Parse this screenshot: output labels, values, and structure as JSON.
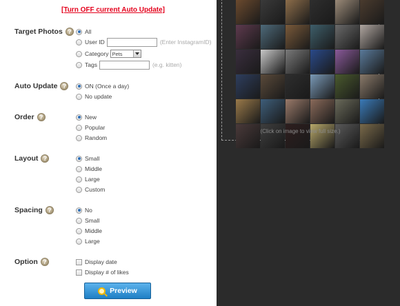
{
  "turn_off_link": "[Turn OFF current Auto Update]",
  "target_photos": {
    "label": "Target Photos",
    "options": [
      {
        "label": "All",
        "selected": true
      },
      {
        "label": "User ID",
        "selected": false,
        "input_value": "",
        "hint": "(Enter InstagramID)"
      },
      {
        "label": "Category",
        "selected": false,
        "select_value": "Pets"
      },
      {
        "label": "Tags",
        "selected": false,
        "input_value": "",
        "hint": "(e.g. kitten)"
      }
    ]
  },
  "auto_update": {
    "label": "Auto Update",
    "options": [
      {
        "label": "ON (Once a day)",
        "selected": true
      },
      {
        "label": "No update",
        "selected": false
      }
    ]
  },
  "order": {
    "label": "Order",
    "options": [
      {
        "label": "New",
        "selected": true
      },
      {
        "label": "Popular",
        "selected": false
      },
      {
        "label": "Random",
        "selected": false
      }
    ]
  },
  "layout": {
    "label": "Layout",
    "options": [
      {
        "label": "Small",
        "selected": true
      },
      {
        "label": "Middle",
        "selected": false
      },
      {
        "label": "Large",
        "selected": false
      },
      {
        "label": "Custom",
        "selected": false
      }
    ]
  },
  "spacing": {
    "label": "Spacing",
    "options": [
      {
        "label": "No",
        "selected": true
      },
      {
        "label": "Small",
        "selected": false
      },
      {
        "label": "Middle",
        "selected": false
      },
      {
        "label": "Large",
        "selected": false
      }
    ]
  },
  "option": {
    "label": "Option",
    "checkboxes": [
      {
        "label": "Display date",
        "checked": false
      },
      {
        "label": "Display # of likes",
        "checked": false
      }
    ]
  },
  "help_icon_glyph": "?",
  "preview_button": "Preview",
  "gallery": {
    "caption": "(Click on image to view full size.)",
    "thumb_colors": [
      "#6b4a2e",
      "#3a3a3a",
      "#8c6d4a",
      "#2e2e2e",
      "#9a8a78",
      "#4a3b2e",
      "#5e3a4e",
      "#4e6a7a",
      "#7a5a3a",
      "#3e5e6a",
      "#6a6a6a",
      "#b0a6a0",
      "#3a2e3e",
      "#c8c8c8",
      "#7a7a7a",
      "#2a4a8a",
      "#8a5a9a",
      "#5a7a9a",
      "#2e3e5e",
      "#5a4a3a",
      "#2e2e2e",
      "#7a9ab8",
      "#4a5a2e",
      "#8a7a6a",
      "#9a7a4a",
      "#3e5e7a",
      "#9a7a6a",
      "#8a6a5a",
      "#6a6a5a",
      "#3a7ab8",
      "#4a3a3a",
      "#3e3e3e",
      "#2e1e1e",
      "#b8a86a",
      "#5a5a5a",
      "#7a6a4a"
    ]
  }
}
